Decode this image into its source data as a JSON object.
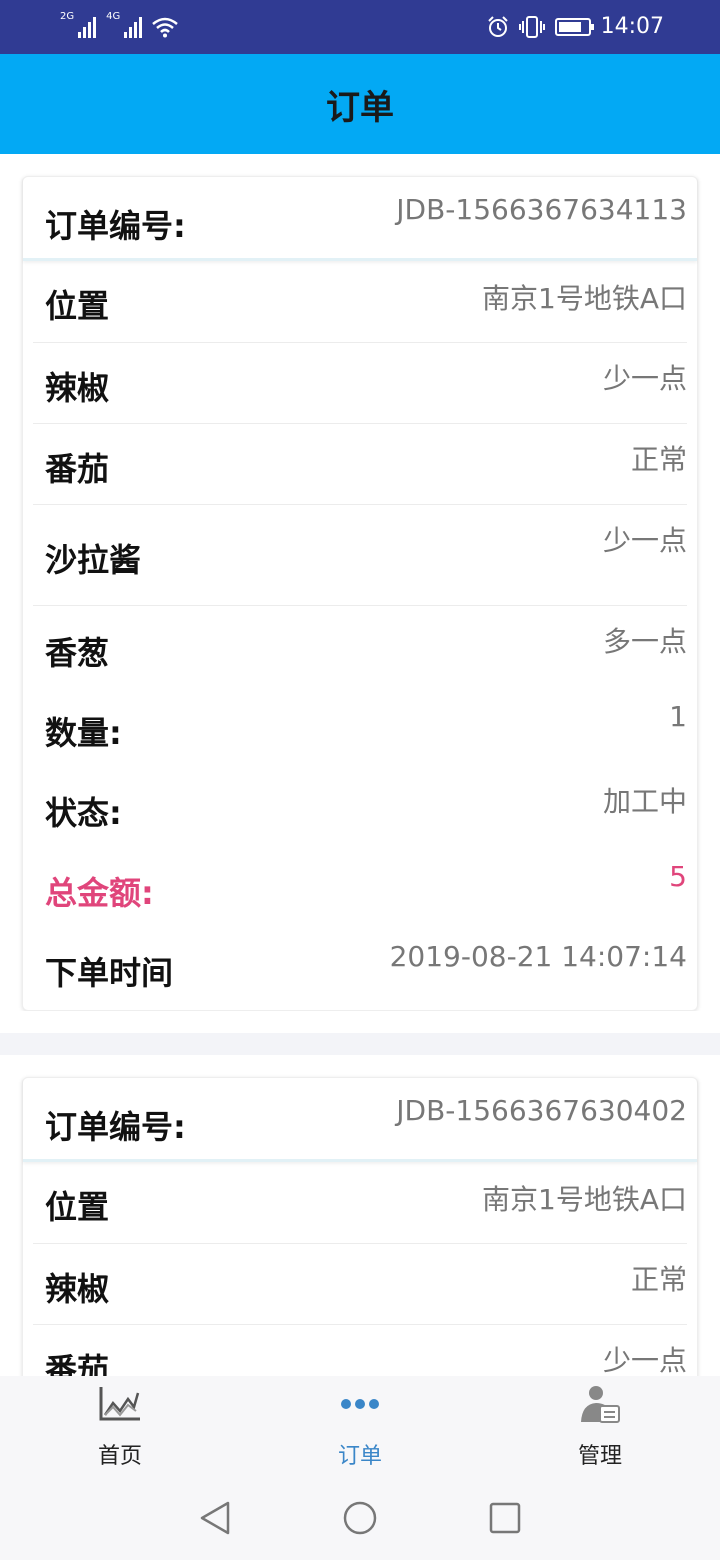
{
  "status_bar": {
    "network1": "2G",
    "network2": "4G",
    "time": "14:07"
  },
  "app_bar": {
    "title": "订单"
  },
  "orders": [
    {
      "order_no_label": "订单编号:",
      "order_no": "JDB-1566367634113",
      "rows": [
        {
          "label": "位置",
          "value": "南京1号地铁A口"
        },
        {
          "label": "辣椒",
          "value": "少一点"
        },
        {
          "label": "番茄",
          "value": "正常"
        },
        {
          "label": "沙拉酱",
          "value": "少一点"
        },
        {
          "label": "香葱",
          "value": "多一点"
        },
        {
          "label": "数量:",
          "value": "1"
        },
        {
          "label": "状态:",
          "value": "加工中"
        },
        {
          "label": "总金额:",
          "value": "5"
        },
        {
          "label": "下单时间",
          "value": "2019-08-21 14:07:14"
        }
      ]
    },
    {
      "order_no_label": "订单编号:",
      "order_no": "JDB-1566367630402",
      "rows": [
        {
          "label": "位置",
          "value": "南京1号地铁A口"
        },
        {
          "label": "辣椒",
          "value": "正常"
        },
        {
          "label": "番茄",
          "value": "少一点"
        }
      ]
    }
  ],
  "bottom_nav": {
    "items": [
      {
        "label": "首页",
        "icon": "chart-icon"
      },
      {
        "label": "订单",
        "icon": "more-dots-icon",
        "active": true
      },
      {
        "label": "管理",
        "icon": "manager-icon"
      }
    ]
  },
  "colors": {
    "status_bar": "#303b93",
    "app_bar": "#03a9f4",
    "active_nav": "#3a86c8",
    "total_amount": "#e0457b"
  }
}
